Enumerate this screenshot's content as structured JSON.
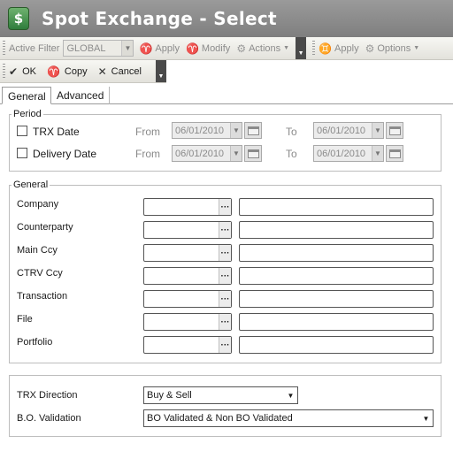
{
  "window": {
    "title": "Spot Exchange - Select",
    "icon": "$"
  },
  "toolbar1": {
    "active_filter_label": "Active Filter",
    "active_filter_value": "GLOBAL",
    "apply_label": "Apply",
    "modify_label": "Modify",
    "actions_label": "Actions",
    "apply2_label": "Apply",
    "options_label": "Options"
  },
  "toolbar2": {
    "ok_label": "OK",
    "copy_label": "Copy",
    "cancel_label": "Cancel"
  },
  "tabs": [
    {
      "label": "General",
      "active": true
    },
    {
      "label": "Advanced",
      "active": false
    }
  ],
  "period": {
    "legend": "Period",
    "from_label": "From",
    "to_label": "To",
    "rows": [
      {
        "label": "TRX Date",
        "from": "06/01/2010",
        "to": "06/01/2010",
        "checked": false
      },
      {
        "label": "Delivery Date",
        "from": "06/01/2010",
        "to": "06/01/2010",
        "checked": false
      }
    ]
  },
  "general": {
    "legend": "General",
    "fields": [
      {
        "label": "Company"
      },
      {
        "label": "Counterparty"
      },
      {
        "label": "Main Ccy"
      },
      {
        "label": "CTRV Ccy"
      },
      {
        "label": "Transaction"
      },
      {
        "label": "File"
      },
      {
        "label": "Portfolio"
      }
    ]
  },
  "filters": {
    "trx_direction": {
      "label": "TRX Direction",
      "value": "Buy & Sell"
    },
    "bo_validation": {
      "label": "B.O. Validation",
      "value": "BO Validated & Non BO Validated"
    }
  }
}
